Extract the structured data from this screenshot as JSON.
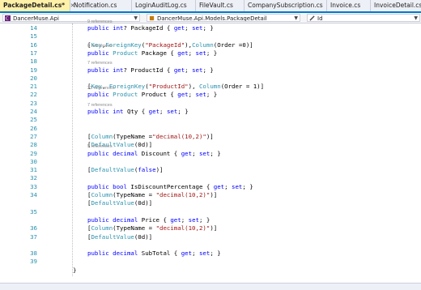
{
  "tabs": [
    {
      "label": "PackageDetail.cs*",
      "close": "✕",
      "active": true
    },
    {
      "label": "Notification.cs",
      "active": false
    },
    {
      "label": "LoginAuditLog.cs",
      "active": false
    },
    {
      "label": "FileVault.cs",
      "active": false
    },
    {
      "label": "CompanySubscription.cs",
      "active": false
    },
    {
      "label": "Invoice.cs",
      "active": false
    },
    {
      "label": "InvoiceDetail.cs",
      "active": false
    }
  ],
  "navbar": {
    "project": "DancerMuse.Api",
    "type": "DancerMuse.Api.Models.PackageDetail",
    "member": "Id"
  },
  "colors": {
    "keyword": "#0000ff",
    "type": "#2b91af",
    "string": "#a31515",
    "line_number": "#2b91af",
    "codelens": "#8a8a8a"
  },
  "lines": [
    {
      "num": "14",
      "lens": "9 references",
      "tokens": [
        [
          "kw",
          "public "
        ],
        [
          "kw",
          "int"
        ],
        [
          "",
          "? PackageId { "
        ],
        [
          "kw",
          "get"
        ],
        [
          "",
          "; "
        ],
        [
          "kw",
          "set"
        ],
        [
          "",
          "; }"
        ]
      ]
    },
    {
      "num": "15",
      "tokens": []
    },
    {
      "num": "16",
      "tokens": [
        [
          "",
          "["
        ],
        [
          "ty",
          "Key"
        ],
        [
          "",
          ","
        ],
        [
          "ty",
          "ForeignKey"
        ],
        [
          "",
          "("
        ],
        [
          "st",
          "\"PackageId\""
        ],
        [
          "",
          "),"
        ],
        [
          "ty",
          "Column"
        ],
        [
          "",
          "(Order =0)]"
        ]
      ]
    },
    {
      "num": "17",
      "lens": "0 references",
      "tokens": [
        [
          "kw",
          "public "
        ],
        [
          "ty",
          "Product"
        ],
        [
          "",
          " Package { "
        ],
        [
          "kw",
          "get"
        ],
        [
          "",
          "; "
        ],
        [
          "kw",
          "set"
        ],
        [
          "",
          "; }"
        ]
      ]
    },
    {
      "num": "18",
      "tokens": []
    },
    {
      "num": "19",
      "lens": "7 references",
      "tokens": [
        [
          "kw",
          "public "
        ],
        [
          "kw",
          "int"
        ],
        [
          "",
          "? ProductId { "
        ],
        [
          "kw",
          "get"
        ],
        [
          "",
          "; "
        ],
        [
          "kw",
          "set"
        ],
        [
          "",
          "; }"
        ]
      ]
    },
    {
      "num": "20",
      "tokens": []
    },
    {
      "num": "21",
      "tokens": [
        [
          "",
          "["
        ],
        [
          "ty",
          "Key"
        ],
        [
          "",
          ", "
        ],
        [
          "ty",
          "ForeignKey"
        ],
        [
          "",
          "("
        ],
        [
          "st",
          "\"ProductId\""
        ],
        [
          "",
          "), "
        ],
        [
          "ty",
          "Column"
        ],
        [
          "",
          "(Order = 1)]"
        ]
      ]
    },
    {
      "num": "22",
      "lens": "33 references",
      "tokens": [
        [
          "kw",
          "public "
        ],
        [
          "ty",
          "Product"
        ],
        [
          "",
          " Product { "
        ],
        [
          "kw",
          "get"
        ],
        [
          "",
          "; "
        ],
        [
          "kw",
          "set"
        ],
        [
          "",
          "; }"
        ]
      ]
    },
    {
      "num": "23",
      "tokens": []
    },
    {
      "num": "24",
      "lens": "7 references",
      "tokens": [
        [
          "kw",
          "public "
        ],
        [
          "kw",
          "int"
        ],
        [
          "",
          " Qty { "
        ],
        [
          "kw",
          "get"
        ],
        [
          "",
          "; "
        ],
        [
          "kw",
          "set"
        ],
        [
          "",
          "; }"
        ]
      ]
    },
    {
      "num": "25",
      "tokens": []
    },
    {
      "num": "26",
      "tokens": []
    },
    {
      "num": "27",
      "tokens": [
        [
          "",
          "["
        ],
        [
          "ty",
          "Column"
        ],
        [
          "",
          "(TypeName ="
        ],
        [
          "st",
          "\"decimal(10,2)\""
        ],
        [
          "",
          ")]"
        ]
      ]
    },
    {
      "num": "28",
      "tokens": [
        [
          "",
          "["
        ],
        [
          "ty",
          "DefaultValue"
        ],
        [
          "",
          "(0d)]"
        ]
      ]
    },
    {
      "num": "29",
      "lens": "5 references",
      "tokens": [
        [
          "kw",
          "public "
        ],
        [
          "kw",
          "decimal"
        ],
        [
          "",
          " Discount { "
        ],
        [
          "kw",
          "get"
        ],
        [
          "",
          "; "
        ],
        [
          "kw",
          "set"
        ],
        [
          "",
          "; }"
        ]
      ]
    },
    {
      "num": "30",
      "tokens": []
    },
    {
      "num": "31",
      "tokens": [
        [
          "",
          "["
        ],
        [
          "ty",
          "DefaultValue"
        ],
        [
          "",
          "("
        ],
        [
          "kw",
          "false"
        ],
        [
          "",
          ")]"
        ]
      ]
    },
    {
      "num": "32",
      "tokens": []
    },
    {
      "num": "33",
      "tokens": [
        [
          "kw",
          "public "
        ],
        [
          "kw",
          "bool"
        ],
        [
          "",
          " IsDiscountPercentage { "
        ],
        [
          "kw",
          "get"
        ],
        [
          "",
          "; "
        ],
        [
          "kw",
          "set"
        ],
        [
          "",
          "; }"
        ]
      ]
    },
    {
      "num": "34",
      "tokens": [
        [
          "",
          "["
        ],
        [
          "ty",
          "Column"
        ],
        [
          "",
          "(TypeName = "
        ],
        [
          "st",
          "\"decimal(10,2)\""
        ],
        [
          "",
          ")]"
        ]
      ]
    },
    {
      "num": "",
      "tokens": [
        [
          "",
          "["
        ],
        [
          "ty",
          "DefaultValue"
        ],
        [
          "",
          "(0d)]"
        ]
      ]
    },
    {
      "num": "35",
      "tokens": []
    },
    {
      "num": "",
      "tokens": [
        [
          "kw",
          "public "
        ],
        [
          "kw",
          "decimal"
        ],
        [
          "",
          " Price { "
        ],
        [
          "kw",
          "get"
        ],
        [
          "",
          "; "
        ],
        [
          "kw",
          "set"
        ],
        [
          "",
          "; }"
        ]
      ]
    },
    {
      "num": "36",
      "tokens": [
        [
          "",
          "["
        ],
        [
          "ty",
          "Column"
        ],
        [
          "",
          "(TypeName = "
        ],
        [
          "st",
          "\"decimal(10,2)\""
        ],
        [
          "",
          ")]"
        ]
      ]
    },
    {
      "num": "37",
      "tokens": [
        [
          "",
          "["
        ],
        [
          "ty",
          "DefaultValue"
        ],
        [
          "",
          "(0d)]"
        ]
      ]
    },
    {
      "num": "",
      "tokens": []
    },
    {
      "num": "38",
      "tokens": [
        [
          "kw",
          "public "
        ],
        [
          "kw",
          "decimal"
        ],
        [
          "",
          " SubTotal { "
        ],
        [
          "kw",
          "get"
        ],
        [
          "",
          "; "
        ],
        [
          "kw",
          "set"
        ],
        [
          "",
          "; }"
        ]
      ]
    },
    {
      "num": "39",
      "tokens": []
    },
    {
      "num": "",
      "tokens": [
        [
          "",
          "}"
        ]
      ]
    }
  ]
}
